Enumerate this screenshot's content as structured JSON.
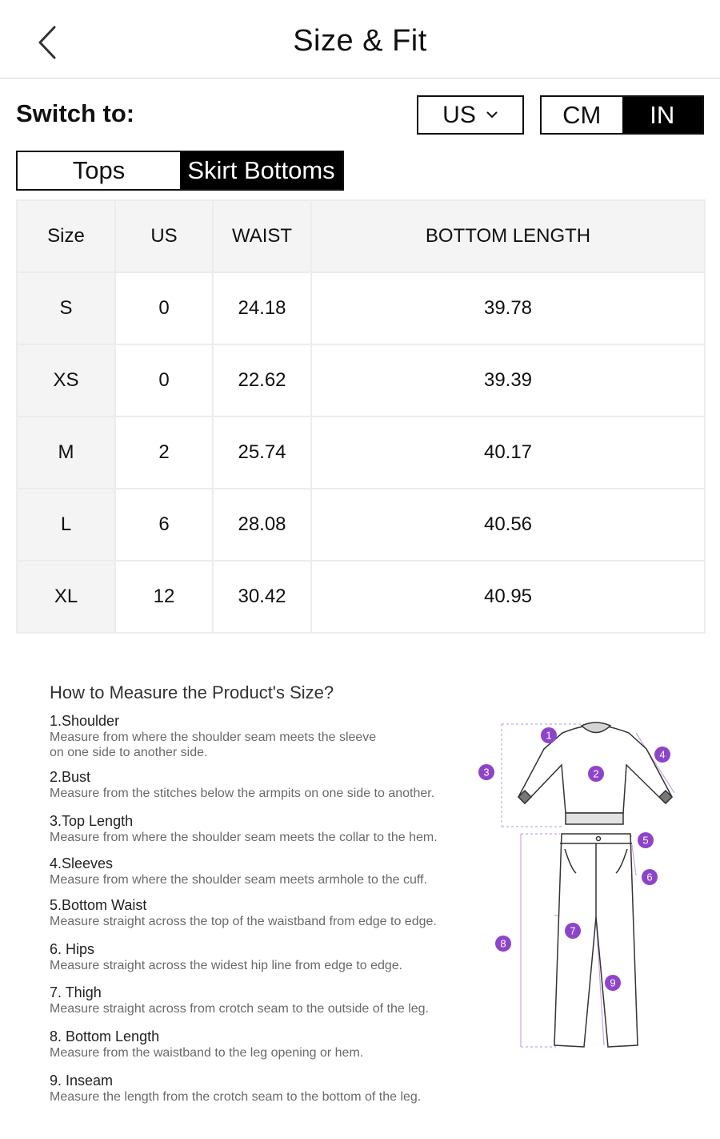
{
  "header": {
    "title": "Size & Fit",
    "back_icon": "chevron-left-icon"
  },
  "switcher": {
    "label": "Switch to:",
    "region": {
      "selected": "US",
      "icon": "chevron-down-icon"
    },
    "units": [
      {
        "label": "CM",
        "active": false
      },
      {
        "label": "IN",
        "active": true
      }
    ]
  },
  "category_tabs": [
    {
      "label": "Tops",
      "active": false
    },
    {
      "label": "Skirt Bottoms",
      "active": true
    }
  ],
  "table": {
    "headers": [
      "Size",
      "US",
      "WAIST",
      "BOTTOM LENGTH"
    ],
    "rows": [
      [
        "S",
        "0",
        "24.18",
        "39.78"
      ],
      [
        "XS",
        "0",
        "22.62",
        "39.39"
      ],
      [
        "M",
        "2",
        "25.74",
        "40.17"
      ],
      [
        "L",
        "6",
        "28.08",
        "40.56"
      ],
      [
        "XL",
        "12",
        "30.42",
        "40.95"
      ]
    ]
  },
  "measure": {
    "title": "How to Measure the Product's Size?",
    "items": [
      {
        "name": "1.Shoulder",
        "desc": [
          "Measure from where the shoulder seam meets the sleeve",
          "on one side to another side."
        ]
      },
      {
        "name": "2.Bust",
        "desc": [
          "Measure from the stitches below the armpits on one side to another."
        ]
      },
      {
        "name": "3.Top Length",
        "desc": [
          "Measure from where the shoulder seam meets the collar to the hem."
        ]
      },
      {
        "name": "4.Sleeves",
        "desc": [
          "Measure from where the shoulder seam meets armhole to the cuff."
        ]
      },
      {
        "name": "5.Bottom Waist",
        "desc": [
          "Measure straight across the top of the waistband from edge to edge."
        ]
      },
      {
        "name": "6. Hips",
        "desc": [
          "Measure straight across the widest hip line from edge to edge."
        ]
      },
      {
        "name": "7. Thigh",
        "desc": [
          "Measure straight across from crotch seam to the outside of the leg."
        ]
      },
      {
        "name": "8. Bottom Length",
        "desc": [
          "Measure from the waistband to the leg opening or hem."
        ]
      },
      {
        "name": "9.  Inseam",
        "desc": [
          "Measure the length from the crotch seam to the bottom of the leg."
        ]
      }
    ],
    "diagram": {
      "marker_color": "#8e44c9",
      "markers": [
        "1",
        "2",
        "3",
        "4",
        "5",
        "6",
        "7",
        "8",
        "9"
      ]
    }
  }
}
